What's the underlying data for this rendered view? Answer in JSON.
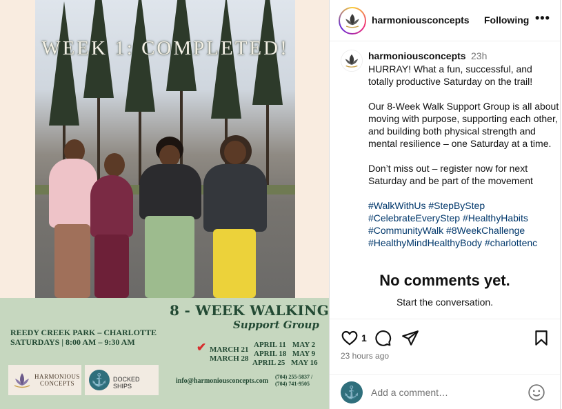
{
  "post_image": {
    "overlay_text": "WEEK 1: COMPLETED!",
    "flyer": {
      "title": "8 - WEEK WALKING",
      "subtitle": "Support Group",
      "location": "REEDY CREEK PARK – CHARLOTTE",
      "schedule": "SATURDAYS | 8:00 AM – 9:30 AM",
      "dates_col1": [
        "MARCH 21",
        "MARCH 28"
      ],
      "dates_col2": [
        "APRIL 11",
        "APRIL 18",
        "APRIL 25"
      ],
      "dates_col3": [
        "MAY 2",
        "MAY 9",
        "MAY 16"
      ],
      "logo_harmonious": [
        "HARMONIOUS",
        "CONCEPTS"
      ],
      "logo_docked": "DOCKED SHIPS",
      "email": "info@harmoniousconcepts.com",
      "phone_1": "(704) 255-5837 /",
      "phone_2": "(704) 741-9505"
    }
  },
  "header": {
    "username": "harmoniousconcepts",
    "following_label": "Following",
    "more_label": "•••"
  },
  "caption": {
    "username": "harmoniousconcepts",
    "time": "23h",
    "paragraph1": "HURRAY! What a fun, successful, and totally productive Saturday on the trail!",
    "paragraph2": "Our 8-Week Walk Support Group is all about moving with purpose, supporting each other, and building both physical strength and mental resilience – one Saturday at a time.",
    "paragraph3": "Don’t miss out – register now for next Saturday and be part of the movement",
    "hashtags": [
      "#WalkWithUs #StepByStep",
      "#CelebrateEveryStep #HealthyHabits",
      "#CommunityWalk #8WeekChallenge",
      "#HealthyMindHealthyBody #charlottenc"
    ]
  },
  "comments": {
    "empty_title": "No comments yet.",
    "empty_subtitle": "Start the conversation."
  },
  "actions": {
    "like_count": "1",
    "timestamp": "23 hours ago",
    "icons": [
      "heart-icon",
      "comment-icon",
      "share-icon",
      "bookmark-icon"
    ]
  },
  "comment_bar": {
    "placeholder": "Add a comment…"
  },
  "colors": {
    "hashtag": "#00376b",
    "flyer_green": "#234a34",
    "flyer_bg": "#c6d7bf",
    "muted": "#737373"
  }
}
